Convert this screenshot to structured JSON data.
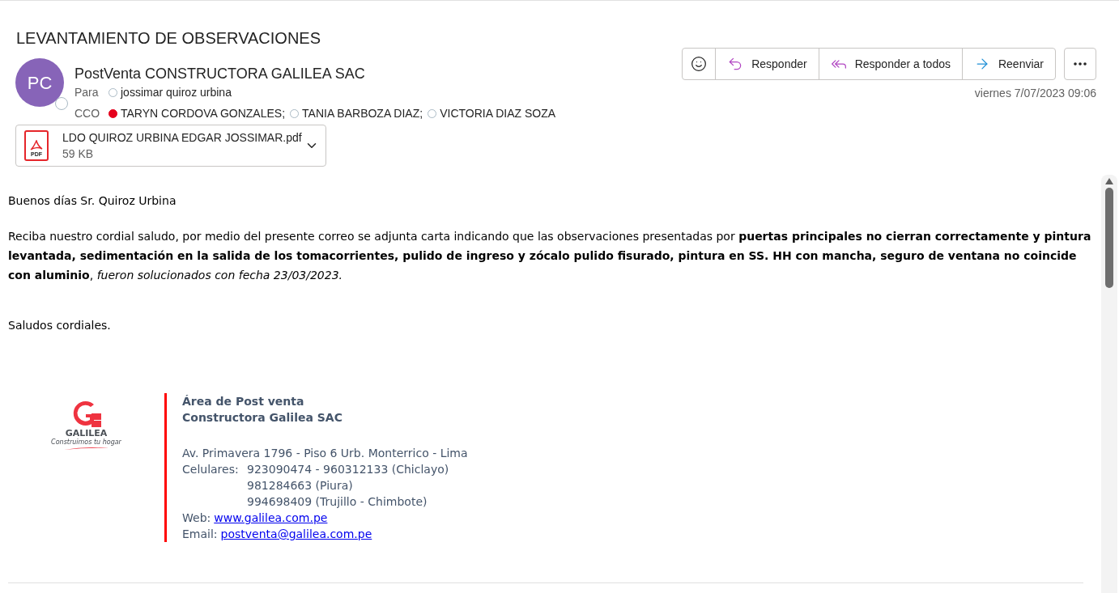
{
  "subject": "LEVANTAMIENTO DE OBSERVACIONES",
  "sender": {
    "initials": "PC",
    "name": "PostVenta CONSTRUCTORA GALILEA SAC"
  },
  "to": {
    "label": "Para",
    "recipients": [
      {
        "name": "jossimar quiroz urbina",
        "busy": false
      }
    ]
  },
  "bcc": {
    "label": "CCO",
    "recipients": [
      {
        "name": "TARYN CORDOVA GONZALES;",
        "busy": true
      },
      {
        "name": "TANIA BARBOZA DIAZ;",
        "busy": false
      },
      {
        "name": "VICTORIA DIAZ SOZA",
        "busy": false
      }
    ]
  },
  "attachment": {
    "name": "LDO QUIROZ URBINA EDGAR JOSSIMAR.pdf",
    "size": "59 KB",
    "badge": "PDF"
  },
  "actions": [
    {
      "kind": "react"
    },
    {
      "kind": "reply",
      "label": "Responder"
    },
    {
      "kind": "reply_all",
      "label": "Responder a todos"
    },
    {
      "kind": "forward",
      "label": "Reenviar"
    }
  ],
  "date": "viernes 7/07/2023 09:06",
  "body": {
    "greeting": "Buenos días Sr. Quiroz Urbina",
    "paragraph": "Reciba nuestro cordial saludo, por medio del presente correo se adjunta carta indicando que las observaciones presentadas por **puertas principales no cierran correctamente y pintura levantada, sedimentación en la salida de los tomacorrientes, pulido de ingreso y zócalo pulido fisurado, pintura en SS. HH con mancha, seguro de ventana no coincide con aluminio**, *fueron solucionados con fecha 23/03/2023.*",
    "closing": "Saludos cordiales."
  },
  "signature": {
    "logo_name": "GALILEA",
    "logo_tagline": "Construimos tu hogar",
    "title_lines": [
      "Área de Post venta",
      "Constructora Galilea SAC"
    ],
    "address": "Av. Primavera 1796 - Piso 6 Urb. Monterrico - Lima",
    "phones_label": "Celulares:",
    "phones": [
      "923090474 - 960312133 (Chiclayo)",
      "981284663 (Piura)",
      "994698409 (Trujillo - Chimbote)"
    ],
    "web_label": "Web:",
    "web": "www.galilea.com.pe",
    "email_label": "Email:",
    "email": "postventa@galilea.com.pe"
  }
}
